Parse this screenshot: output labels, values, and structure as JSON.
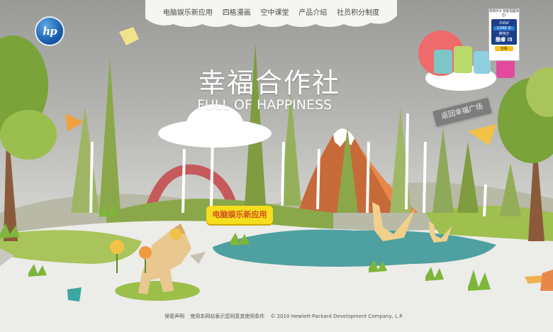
{
  "nav": {
    "items": [
      {
        "label": "电脑娱乐新应用"
      },
      {
        "label": "四格漫画"
      },
      {
        "label": "空中课堂"
      },
      {
        "label": "产品介绍"
      },
      {
        "label": "社员积分制度"
      }
    ]
  },
  "logo": {
    "text": "hp"
  },
  "title": {
    "cn": "幸福合作社",
    "en": "FULL OF HAPPINESS"
  },
  "signs": {
    "back": "返回幸福广场",
    "center": "电脑娱乐新应用"
  },
  "intel": {
    "top_text": "英特尔® 智能电脑你芯!",
    "brand": "intel",
    "core": "CORE i5",
    "cn_name": "英特尔",
    "cn_core": "酷睿 i5",
    "tag": "全新"
  },
  "footer": {
    "privacy": "保密声明",
    "terms": "使用本网站表示您同意其使用条件",
    "copyright": "© 2010 Hewlett-Packard Development Company, L.P."
  },
  "colors": {
    "ground": "#e9e9e6",
    "grass": "#7db63a",
    "tree_dark": "#6c8d2e",
    "tree_light": "#a9c45a",
    "lake": "#4fa0a0",
    "mountain": "#e8864a",
    "sun": "#ef6a6a",
    "sign_yellow": "#f6dd1e"
  }
}
